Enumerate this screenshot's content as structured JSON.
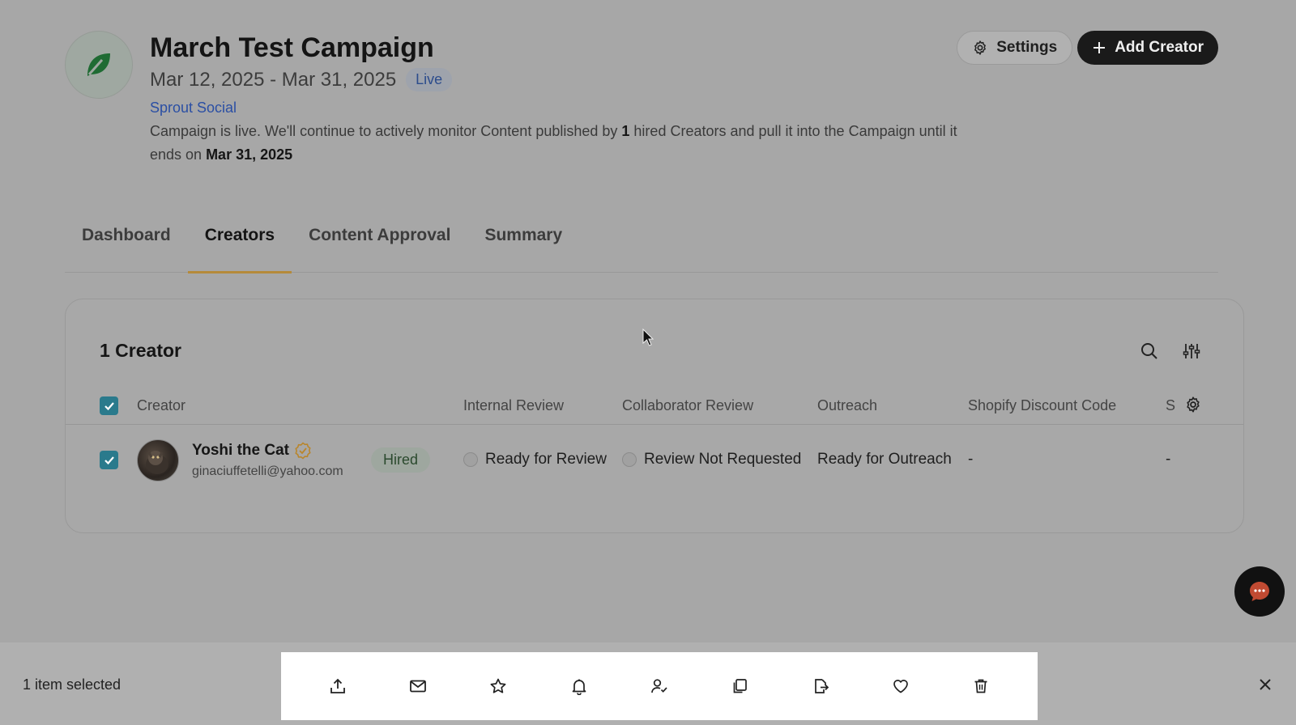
{
  "campaign": {
    "title": "March Test Campaign",
    "dates": "Mar 12, 2025 - Mar 31, 2025",
    "status": "Live",
    "brand": "Sprout Social",
    "desc_part1": "Campaign is live. We'll continue to actively monitor Content published by ",
    "desc_count": "1",
    "desc_part2": " hired Creators and pull it into the Campaign until it ends on ",
    "desc_end_date": "Mar 31, 2025"
  },
  "header_buttons": {
    "settings": "Settings",
    "add_creator": "Add Creator"
  },
  "tabs": [
    {
      "label": "Dashboard"
    },
    {
      "label": "Creators"
    },
    {
      "label": "Content Approval"
    },
    {
      "label": "Summary"
    }
  ],
  "table": {
    "title": "1 Creator",
    "columns": [
      "Creator",
      "Internal Review",
      "Collaborator Review",
      "Outreach",
      "Shopify Discount Code",
      "S"
    ],
    "rows": [
      {
        "name": "Yoshi the Cat",
        "email": "ginaciuffetelli@yahoo.com",
        "status": "Hired",
        "internal_review": "Ready for Review",
        "collaborator_review": "Review Not Requested",
        "outreach": "Ready for Outreach",
        "discount_code": "-",
        "s_value": "-"
      }
    ]
  },
  "selection": {
    "text": "1 item selected"
  },
  "icons": [
    "export-icon",
    "mail-icon",
    "star-icon",
    "bell-icon",
    "assign-user-icon",
    "copy-icon",
    "move-icon",
    "heart-icon",
    "trash-icon"
  ],
  "colors": {
    "accent": "#b58a3a",
    "checkbox": "#2a7a8c",
    "brand_link": "#2b4fa4",
    "primary_button": "#1a1a1a"
  }
}
